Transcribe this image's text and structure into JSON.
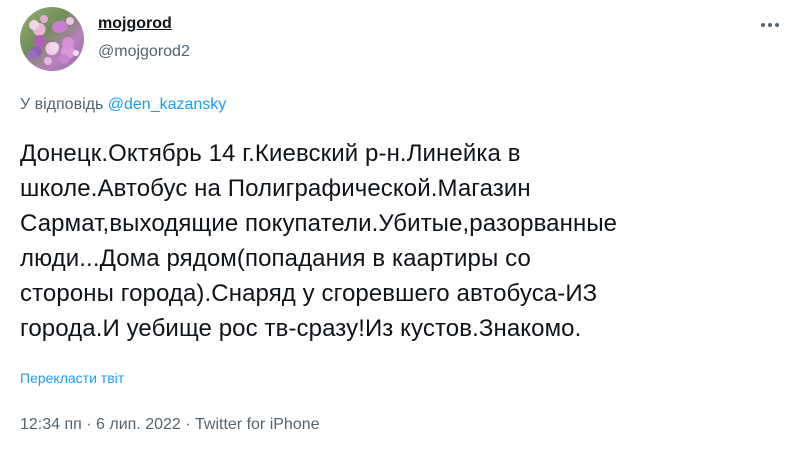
{
  "user": {
    "name": "mojgorod",
    "handle": "@mojgorod2"
  },
  "reply": {
    "prefix": "У відповідь",
    "mention": "@den_kazansky"
  },
  "tweet": {
    "lines": [
      "Донецк.Октябрь 14 г.Киевский р-н.Линейка в",
      "школе.Автобус на Полиграфической.Магазин",
      "Сармат,выходящие покупатели.Убитые,разорванные",
      "люди...Дома рядом(попадания в каартиры со",
      "стороны города).Снаряд у сгоревшего автобуса-ИЗ",
      "города.И уебище рос тв-сразу!Из кустов.Знакомо."
    ]
  },
  "translate_label": "Перекласти твіт",
  "meta": "12:34 пп · 6 лип. 2022 · Twitter for iPhone",
  "icons": {
    "avatar": "flowers-avatar",
    "more": "more-options-icon"
  },
  "colors": {
    "link": "#1d9bf0",
    "secondary": "#536471",
    "text": "#0f1419"
  }
}
